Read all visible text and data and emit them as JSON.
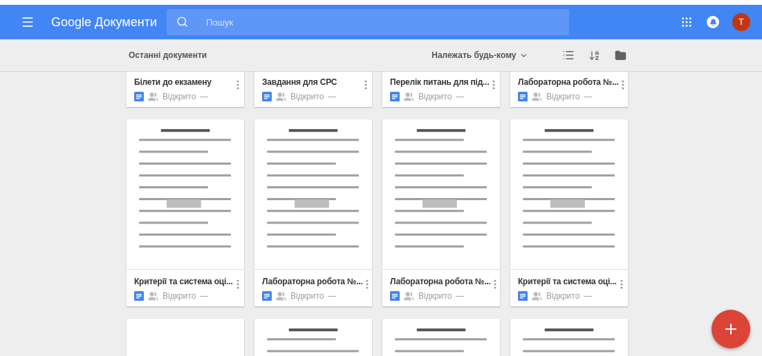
{
  "header": {
    "title": "Google Документи",
    "search": {
      "placeholder": "Пошук"
    },
    "avatar": "T"
  },
  "toolbar": {
    "title": "Останні документи",
    "owner_filter": "Належать будь-кому"
  },
  "rows": [
    {
      "documents": [
        {
          "title": "Білети до екзамену",
          "status": "Відкрито",
          "modified": "—"
        },
        {
          "title": "Завдання для СРС",
          "status": "Відкрито",
          "modified": "—"
        },
        {
          "title": "Перелік питань для під...",
          "status": "Відкрито",
          "modified": "—"
        },
        {
          "title": "Лабораторна робота №...",
          "status": "Відкрито",
          "modified": "—"
        }
      ]
    },
    {
      "documents": [
        {
          "thumbnail": {
            "kind": "picture"
          },
          "title": "Критерії та система оці...",
          "status": "Відкрито",
          "modified": "—"
        },
        {
          "thumbnail": {
            "kind": "picture"
          },
          "title": "Лабораторна робота №...",
          "status": "Відкрито",
          "modified": "—"
        },
        {
          "thumbnail": {
            "kind": "picture"
          },
          "title": "Лабораторна робота №...",
          "status": "Відкрито",
          "modified": "—"
        },
        {
          "thumbnail": {
            "kind": "picture"
          },
          "title": "Критерії та система оці...",
          "status": "Відкрито",
          "modified": "—"
        }
      ]
    },
    {
      "documents": [
        {
          "thumbnail": {
            "kind": "blank"
          }
        },
        {
          "thumbnail": {
            "kind": "picture"
          }
        },
        {
          "thumbnail": {
            "kind": "picture"
          }
        },
        {
          "thumbnail": {
            "kind": "picture"
          }
        }
      ]
    }
  ]
}
